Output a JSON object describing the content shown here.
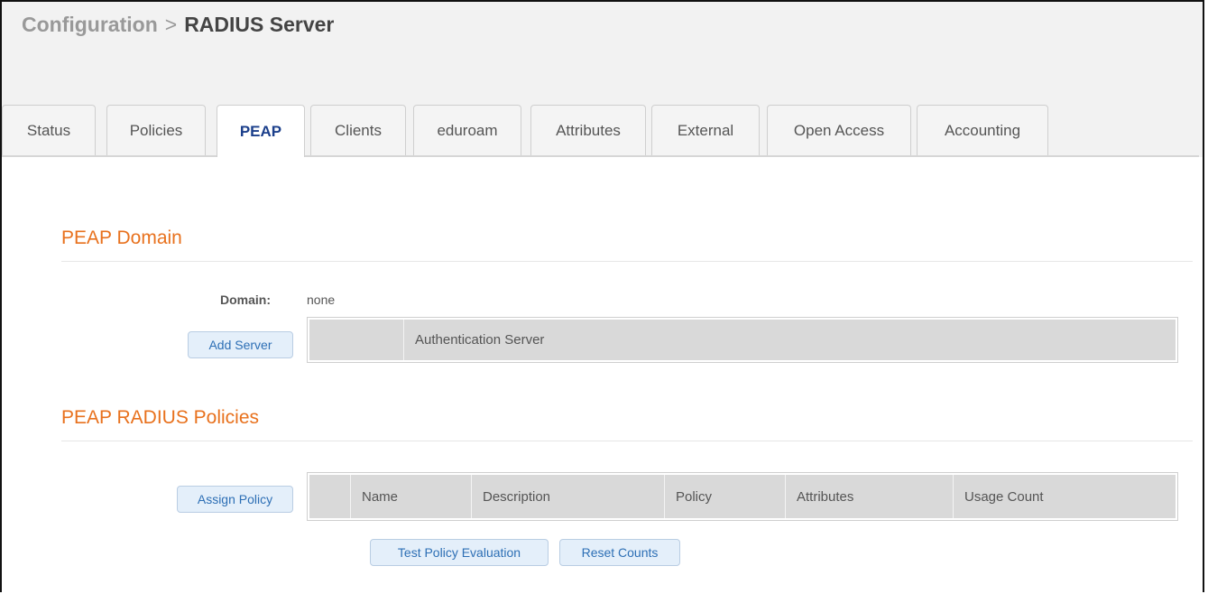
{
  "breadcrumb": {
    "parent": "Configuration",
    "separator": ">",
    "current": "RADIUS Server"
  },
  "tabs": [
    {
      "label": "Status",
      "active": false
    },
    {
      "label": "Policies",
      "active": false
    },
    {
      "label": "PEAP",
      "active": true
    },
    {
      "label": "Clients",
      "active": false
    },
    {
      "label": "eduroam",
      "active": false
    },
    {
      "label": "Attributes",
      "active": false
    },
    {
      "label": "External",
      "active": false
    },
    {
      "label": "Open Access",
      "active": false
    },
    {
      "label": "Accounting",
      "active": false
    }
  ],
  "peap_domain": {
    "title": "PEAP Domain",
    "domain_label": "Domain:",
    "domain_value": "none",
    "add_server_label": "Add Server",
    "table_headers": [
      "",
      "Authentication Server"
    ]
  },
  "peap_policies": {
    "title": "PEAP RADIUS Policies",
    "assign_policy_label": "Assign Policy",
    "table_headers": [
      "",
      "Name",
      "Description",
      "Policy",
      "Attributes",
      "Usage Count"
    ],
    "test_policy_label": "Test Policy Evaluation",
    "reset_counts_label": "Reset Counts"
  },
  "colors": {
    "accent_orange": "#e8711d",
    "active_tab_text": "#1b3f8b",
    "button_text": "#2d6fb5",
    "button_bg": "#e4effa"
  }
}
